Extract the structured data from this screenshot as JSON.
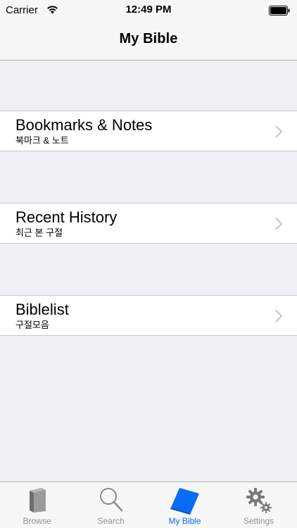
{
  "status_bar": {
    "carrier": "Carrier",
    "time": "12:49 PM"
  },
  "nav": {
    "title": "My Bible"
  },
  "rows": [
    {
      "title": "Bookmarks & Notes",
      "subtitle": "북마크 & 노트"
    },
    {
      "title": "Recent History",
      "subtitle": "최근 본 구절"
    },
    {
      "title": "Biblelist",
      "subtitle": "구절모음"
    }
  ],
  "tabs": [
    {
      "label": "Browse",
      "icon": "book-icon",
      "active": false
    },
    {
      "label": "Search",
      "icon": "search-icon",
      "active": false
    },
    {
      "label": "My Bible",
      "icon": "bible-icon",
      "active": true
    },
    {
      "label": "Settings",
      "icon": "gear-icon",
      "active": false
    }
  ],
  "colors": {
    "background": "#EFEFF4",
    "bar": "#F7F7F7",
    "active_tint": "#0A6CF5",
    "inactive_tint": "#929292",
    "chevron": "#C7C7CC"
  }
}
